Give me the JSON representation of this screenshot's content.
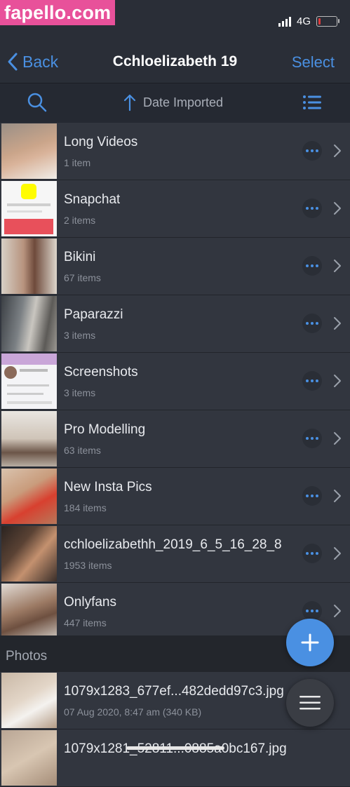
{
  "watermark": "fapello.com",
  "status": {
    "network": "4G"
  },
  "nav": {
    "back_label": "Back",
    "title": "Cchloelizabeth 19",
    "select_label": "Select"
  },
  "toolbar": {
    "sort_label": "Date Imported"
  },
  "folders": [
    {
      "name": "Long Videos",
      "count": "1 item"
    },
    {
      "name": "Snapchat",
      "count": "2 items"
    },
    {
      "name": "Bikini",
      "count": "67 items"
    },
    {
      "name": "Paparazzi",
      "count": "3 items"
    },
    {
      "name": "Screenshots",
      "count": "3 items"
    },
    {
      "name": "Pro Modelling",
      "count": "63 items"
    },
    {
      "name": "New Insta Pics",
      "count": "184 items"
    },
    {
      "name": "cchloelizabethh_2019_6_5_16_28_8",
      "count": "1953 items"
    },
    {
      "name": "Onlyfans",
      "count": "447 items"
    }
  ],
  "photos_section": {
    "title": "Photos"
  },
  "photos": [
    {
      "name": "1079x1283_677ef...482dedd97c3.jpg",
      "meta": "07 Aug 2020, 8:47 am (340 KB)"
    },
    {
      "name": "1079x1281_52811...0885a0bc167.jpg",
      "meta": ""
    }
  ],
  "colors": {
    "accent": "#4a90e2",
    "row_bg": "#32363f",
    "bar_bg": "#2a2e37",
    "watermark_bg": "#e8519a"
  }
}
